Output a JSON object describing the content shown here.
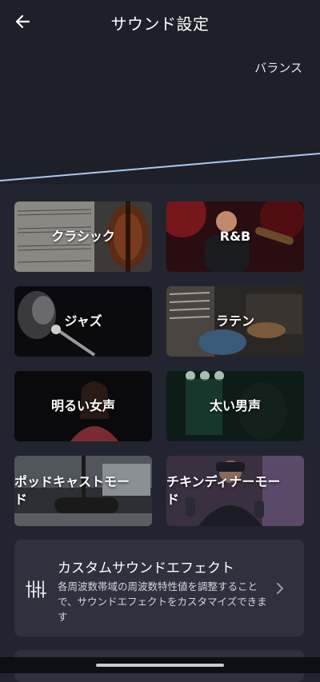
{
  "header": {
    "title": "サウンド設定"
  },
  "balance_label": "バランス",
  "presets": [
    {
      "label": "クラシック"
    },
    {
      "label": "R&B"
    },
    {
      "label": "ジャズ"
    },
    {
      "label": "ラテン"
    },
    {
      "label": "明るい女声"
    },
    {
      "label": "太い男声"
    },
    {
      "label_line1": "ポッドキャストモー",
      "label_line2": "ド"
    },
    {
      "label_line1": "チキンディナーモー",
      "label_line2": "ド"
    }
  ],
  "custom_effect": {
    "title": "カスタムサウンドエフェクト",
    "description": "各周波数帯域の周波数特性値を調整することで、サウンドエフェクトをカスタマイズできます"
  },
  "colors": {
    "background": "#22252f",
    "card": "#2f323d",
    "curve": "#a9c8f0"
  }
}
